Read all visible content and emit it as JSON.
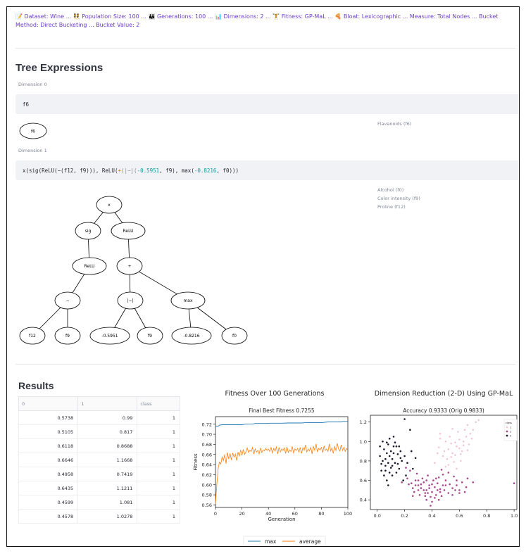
{
  "params": {
    "text": "📝 Dataset: Wine ... 👯 Population Size: 100 ... 👪 Generations: 100 ... 📊 Dimensions: 2 ... 🏋 Fitness: GP-MaL ... 🍕 Bloat: Lexicographic ... Measure: Total Nodes ... Bucket Method: Direct Bucketing ... Bucket Value: 2"
  },
  "tree_section": {
    "title": "Tree Expressions",
    "dim0": {
      "label": "Dimension 0",
      "expr": "f6",
      "node": "f6",
      "features": [
        "Flavanoids (f6)"
      ]
    },
    "dim1": {
      "label": "Dimension 1",
      "expr": {
        "p1": "x(sig(ReLU(−(f12, f9))), ReLU(",
        "p2": "+",
        "p3": "(",
        "p4": "|−|",
        "p5": "(",
        "n1": "-0.5951",
        "p6": ", f9), max(",
        "n2": "-0.8216",
        "p7": ", f0)))"
      },
      "features": [
        "Alcohol (f0)",
        "Color intensity (f9)",
        "Proline (f12)"
      ],
      "tree_nodes": {
        "root": "x",
        "sig": "sig",
        "relu_r": "ReLU",
        "relu_l": "ReLU",
        "plus": "+",
        "minus": "−",
        "absdiff": "|−|",
        "max": "max",
        "f12": "f12",
        "f9a": "f9",
        "c1": "-0.5951",
        "f9b": "f9",
        "c2": "-0.8216",
        "f0": "f0"
      }
    }
  },
  "results": {
    "title": "Results",
    "table": {
      "columns": [
        "0",
        "1",
        "class"
      ],
      "rows": [
        [
          "0.5738",
          "0.99",
          "1"
        ],
        [
          "0.5105",
          "0.817",
          "1"
        ],
        [
          "0.6118",
          "0.8688",
          "1"
        ],
        [
          "0.6646",
          "1.1668",
          "1"
        ],
        [
          "0.4958",
          "0.7419",
          "1"
        ],
        [
          "0.6435",
          "1.1211",
          "1"
        ],
        [
          "0.4599",
          "1.081",
          "1"
        ],
        [
          "0.4578",
          "1.0278",
          "1"
        ]
      ]
    }
  },
  "colors": {
    "accent": "#6a3dc4",
    "max_line": "#1f77b4",
    "avg_line": "#ff7f0e",
    "class0": "#1b1b2f",
    "class1": "#a8478e",
    "class2": "#f2c6d9"
  },
  "chart_data": [
    {
      "type": "line",
      "title": "Fitness Over 100 Generations",
      "subtitle": "Final Best Fitness 0.7255",
      "xlabel": "Generation",
      "ylabel": "Fitness",
      "xlim": [
        0,
        100
      ],
      "ylim": [
        0.555,
        0.735
      ],
      "xticks": [
        0,
        20,
        40,
        60,
        80,
        100
      ],
      "yticks": [
        0.56,
        0.58,
        0.6,
        0.62,
        0.64,
        0.66,
        0.68,
        0.7,
        0.72
      ],
      "legend_placement": "bottom",
      "series": [
        {
          "name": "max",
          "points": [
            [
              0,
              0.716
            ],
            [
              2,
              0.716
            ],
            [
              3,
              0.718
            ],
            [
              5,
              0.719
            ],
            [
              10,
              0.719
            ],
            [
              20,
              0.719
            ],
            [
              23,
              0.7205
            ],
            [
              28,
              0.7205
            ],
            [
              30,
              0.7215
            ],
            [
              40,
              0.7215
            ],
            [
              41,
              0.722
            ],
            [
              50,
              0.722
            ],
            [
              55,
              0.7225
            ],
            [
              65,
              0.7225
            ],
            [
              68,
              0.723
            ],
            [
              80,
              0.723
            ],
            [
              85,
              0.7245
            ],
            [
              95,
              0.7245
            ],
            [
              96,
              0.7255
            ],
            [
              100,
              0.7255
            ]
          ]
        },
        {
          "name": "average",
          "values": [
            0.562,
            0.6,
            0.632,
            0.645,
            0.641,
            0.655,
            0.648,
            0.66,
            0.642,
            0.664,
            0.651,
            0.662,
            0.649,
            0.663,
            0.655,
            0.661,
            0.648,
            0.665,
            0.656,
            0.669,
            0.658,
            0.67,
            0.66,
            0.665,
            0.673,
            0.664,
            0.668,
            0.666,
            0.674,
            0.661,
            0.671,
            0.665,
            0.668,
            0.661,
            0.673,
            0.664,
            0.669,
            0.667,
            0.672,
            0.668,
            0.671,
            0.666,
            0.674,
            0.663,
            0.672,
            0.667,
            0.675,
            0.661,
            0.674,
            0.665,
            0.671,
            0.668,
            0.673,
            0.662,
            0.675,
            0.664,
            0.669,
            0.666,
            0.676,
            0.663,
            0.671,
            0.668,
            0.672,
            0.665,
            0.674,
            0.662,
            0.673,
            0.668,
            0.679,
            0.665,
            0.671,
            0.667,
            0.674,
            0.661,
            0.676,
            0.668,
            0.681,
            0.665,
            0.672,
            0.669,
            0.674,
            0.664,
            0.677,
            0.668,
            0.671,
            0.666,
            0.681,
            0.667,
            0.673,
            0.662,
            0.676,
            0.668,
            0.682,
            0.671,
            0.667,
            0.679,
            0.668,
            0.674,
            0.666,
            0.672,
            0.668
          ]
        }
      ]
    },
    {
      "type": "scatter",
      "title": "Dimension Reduction (2-D) Using GP-MaL",
      "subtitle": "Accuracy 0.9333 (Orig 0.9833)",
      "xlim": [
        -0.05,
        1.02
      ],
      "ylim": [
        0.3,
        1.27
      ],
      "xticks": [
        0.0,
        0.2,
        0.4,
        0.6,
        0.8,
        1.0
      ],
      "yticks": [
        0.4,
        0.6,
        0.8,
        1.0,
        1.2
      ],
      "legend_title": "class",
      "legend_labels": [
        "1",
        "2",
        "3"
      ],
      "legend_placement": "top-right",
      "series": [
        {
          "name": "1",
          "points": [
            [
              0.57,
              0.99
            ],
            [
              0.51,
              0.82
            ],
            [
              0.61,
              0.87
            ],
            [
              0.66,
              1.17
            ],
            [
              0.5,
              0.74
            ],
            [
              0.64,
              1.12
            ],
            [
              0.46,
              1.08
            ],
            [
              0.46,
              1.03
            ],
            [
              0.52,
              0.92
            ],
            [
              0.55,
              0.88
            ],
            [
              0.58,
              0.95
            ],
            [
              0.6,
              1.02
            ],
            [
              0.63,
              0.96
            ],
            [
              0.54,
              0.98
            ],
            [
              0.49,
              0.9
            ],
            [
              0.57,
              0.86
            ],
            [
              0.62,
              0.9
            ],
            [
              0.53,
              1.05
            ],
            [
              0.59,
              1.1
            ],
            [
              0.65,
              1.05
            ],
            [
              0.68,
              1.08
            ],
            [
              0.7,
              1.12
            ],
            [
              0.72,
              1.2
            ],
            [
              0.48,
              0.85
            ],
            [
              0.45,
              0.94
            ],
            [
              0.56,
              0.79
            ],
            [
              0.61,
              0.8
            ],
            [
              0.67,
              0.97
            ],
            [
              0.52,
              0.76
            ],
            [
              0.58,
              0.72
            ],
            [
              0.63,
              1.0
            ],
            [
              0.55,
              1.13
            ],
            [
              0.5,
              1.0
            ],
            [
              0.44,
              0.88
            ],
            [
              0.6,
              0.93
            ],
            [
              0.66,
              0.91
            ],
            [
              0.42,
              0.78
            ],
            [
              0.69,
              1.03
            ],
            [
              0.74,
              1.22
            ],
            [
              0.54,
              0.84
            ]
          ]
        },
        {
          "name": "2",
          "points": [
            [
              0.22,
              0.62
            ],
            [
              0.25,
              0.57
            ],
            [
              0.28,
              0.55
            ],
            [
              0.3,
              0.6
            ],
            [
              0.32,
              0.52
            ],
            [
              0.34,
              0.58
            ],
            [
              0.36,
              0.5
            ],
            [
              0.38,
              0.55
            ],
            [
              0.4,
              0.48
            ],
            [
              0.42,
              0.53
            ],
            [
              0.44,
              0.57
            ],
            [
              0.46,
              0.51
            ],
            [
              0.48,
              0.55
            ],
            [
              0.5,
              0.6
            ],
            [
              0.52,
              0.47
            ],
            [
              0.55,
              0.52
            ],
            [
              0.58,
              0.55
            ],
            [
              0.6,
              0.5
            ],
            [
              0.62,
              0.58
            ],
            [
              0.65,
              0.53
            ],
            [
              0.27,
              0.48
            ],
            [
              0.31,
              0.45
            ],
            [
              0.35,
              0.47
            ],
            [
              0.39,
              0.43
            ],
            [
              0.43,
              0.45
            ],
            [
              0.47,
              0.44
            ],
            [
              0.33,
              0.62
            ],
            [
              0.37,
              0.65
            ],
            [
              0.41,
              0.6
            ],
            [
              0.45,
              0.63
            ],
            [
              0.29,
              0.67
            ],
            [
              0.24,
              0.7
            ],
            [
              0.21,
              0.73
            ],
            [
              0.26,
              0.52
            ],
            [
              0.36,
              0.4
            ],
            [
              0.4,
              0.38
            ],
            [
              0.52,
              0.68
            ],
            [
              0.56,
              0.64
            ],
            [
              0.48,
              0.66
            ],
            [
              0.6,
              0.47
            ],
            [
              0.18,
              0.58
            ],
            [
              0.34,
              0.5
            ],
            [
              0.3,
              0.5
            ],
            [
              0.44,
              0.5
            ],
            [
              0.53,
              0.56
            ],
            [
              0.38,
              0.52
            ],
            [
              0.42,
              0.42
            ],
            [
              0.5,
              0.55
            ],
            [
              0.64,
              0.48
            ],
            [
              0.23,
              0.56
            ],
            [
              0.39,
              0.34
            ],
            [
              0.47,
              0.71
            ],
            [
              0.58,
              0.6
            ],
            [
              0.46,
              0.48
            ],
            [
              0.32,
              0.56
            ],
            [
              0.36,
              0.6
            ],
            [
              0.28,
              0.6
            ],
            [
              0.4,
              0.56
            ],
            [
              0.45,
              0.4
            ],
            [
              0.55,
              0.45
            ],
            [
              0.66,
              0.62
            ],
            [
              0.7,
              0.58
            ],
            [
              0.26,
              0.44
            ],
            [
              0.35,
              0.44
            ],
            [
              0.49,
              0.5
            ],
            [
              0.43,
              0.62
            ],
            [
              0.37,
              0.47
            ],
            [
              0.57,
              0.5
            ],
            [
              0.3,
              0.55
            ],
            [
              1.0,
              0.57
            ]
          ]
        },
        {
          "name": "3",
          "points": [
            [
              0.02,
              0.85
            ],
            [
              0.04,
              0.8
            ],
            [
              0.05,
              0.92
            ],
            [
              0.06,
              0.75
            ],
            [
              0.07,
              0.88
            ],
            [
              0.08,
              0.97
            ],
            [
              0.09,
              1.03
            ],
            [
              0.1,
              0.9
            ],
            [
              0.11,
              0.82
            ],
            [
              0.12,
              1.05
            ],
            [
              0.13,
              0.78
            ],
            [
              0.14,
              0.95
            ],
            [
              0.15,
              0.87
            ],
            [
              0.16,
              0.72
            ],
            [
              0.17,
              0.83
            ],
            [
              0.03,
              0.7
            ],
            [
              0.05,
              0.65
            ],
            [
              0.07,
              0.6
            ],
            [
              0.09,
              0.68
            ],
            [
              0.11,
              0.75
            ],
            [
              0.02,
              0.95
            ],
            [
              0.04,
              1.0
            ],
            [
              0.06,
              0.82
            ],
            [
              0.08,
              0.78
            ],
            [
              0.1,
              0.73
            ],
            [
              0.12,
              0.88
            ],
            [
              0.14,
              0.68
            ],
            [
              0.16,
              0.95
            ],
            [
              0.18,
              0.8
            ],
            [
              0.2,
              0.85
            ],
            [
              0.22,
              0.78
            ],
            [
              0.24,
              1.12
            ],
            [
              0.25,
              0.9
            ],
            [
              0.21,
              0.65
            ],
            [
              0.19,
              0.6
            ],
            [
              0.2,
              1.23
            ],
            [
              0.07,
              0.99
            ],
            [
              0.06,
              0.7
            ],
            [
              0.08,
              0.55
            ],
            [
              0.12,
              0.95
            ],
            [
              0.15,
              0.77
            ],
            [
              0.28,
              0.83
            ],
            [
              0.03,
              0.77
            ],
            [
              0.09,
              0.85
            ],
            [
              0.13,
              0.99
            ],
            [
              0.17,
              0.9
            ],
            [
              0.26,
              0.72
            ],
            [
              0.11,
              0.65
            ]
          ]
        }
      ]
    }
  ]
}
